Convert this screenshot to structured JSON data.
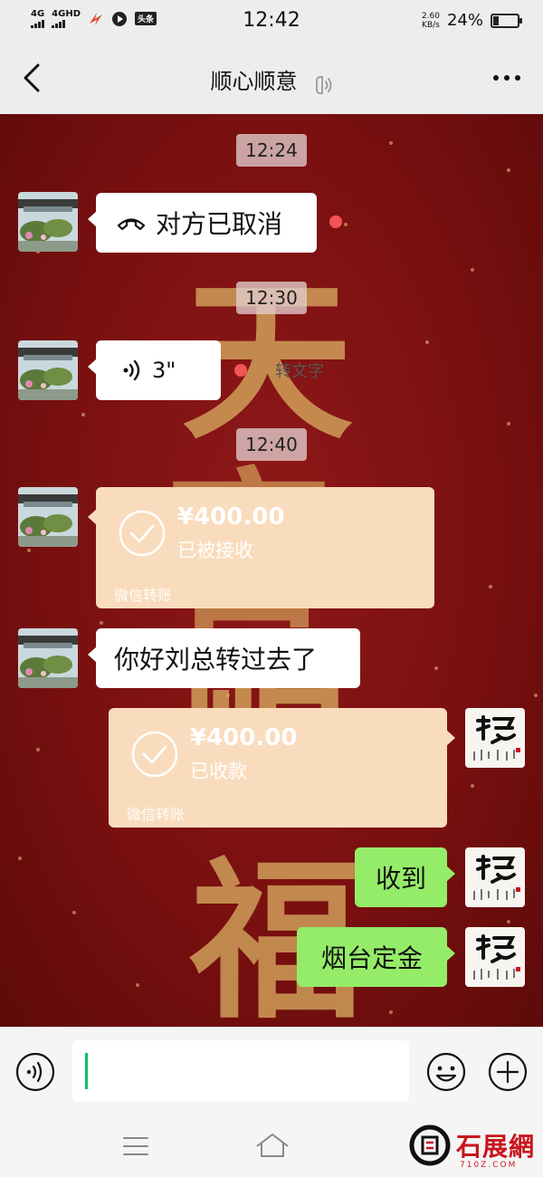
{
  "status_bar": {
    "network_1": "4G",
    "network_2": "4GHD",
    "app_badge": "头条",
    "time": "12:42",
    "speed_value": "2.60",
    "speed_unit": "KB/s",
    "battery_percent": "24%",
    "battery_level": 0.24
  },
  "header": {
    "title": "顺心顺意"
  },
  "background_chars": [
    "天",
    "官",
    "赐",
    "福"
  ],
  "messages": {
    "time_1": "12:24",
    "call_cancelled": "对方已取消",
    "time_2": "12:30",
    "voice_duration": "3\"",
    "convert_to_text": "转文字",
    "time_3": "12:40",
    "transfer_1": {
      "amount": "¥400.00",
      "status": "已被接收",
      "label": "微信转账"
    },
    "text_1": "你好刘总转过去了",
    "transfer_2": {
      "amount": "¥400.00",
      "status": "已收款",
      "label": "微信转账"
    },
    "reply_1": "收到",
    "reply_2": "烟台定金"
  },
  "input": {
    "placeholder": ""
  },
  "watermark": {
    "text": "石展網",
    "url": "710Z.COM"
  },
  "colors": {
    "chat_bg": "#7a1010",
    "transfer_bubble": "#f9dcbd",
    "sent_bubble": "#95ec69",
    "unread_dot": "#f25454",
    "caret": "#07c160"
  }
}
